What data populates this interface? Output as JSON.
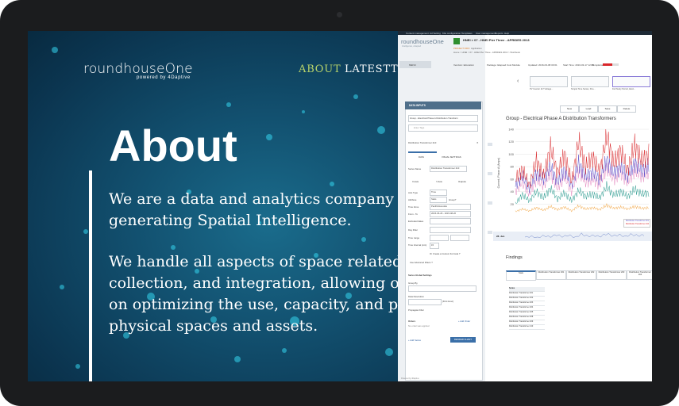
{
  "website": {
    "logo": "roundhouseOne",
    "logo_sub": "powered by 4Daptive",
    "nav": [
      "ABOUT",
      "LATEST",
      "T"
    ],
    "title": "About",
    "paragraphs": [
      "We are a data and analytics company",
      "generating Spatial Intelligence.",
      "We handle all aspects of space related",
      "collection, and integration, allowing ou",
      "on optimizing the use, capacity, and pe",
      "physical spaces and assets."
    ]
  },
  "app": {
    "brand": "roundhouseOne",
    "brand_sub": "Intelligence, Adapted",
    "top_menu": [
      "Content management",
      "Ad Setting",
      "Kite configuration",
      "Templates",
      "User management",
      "Reports",
      "Help"
    ],
    "menu_label": "MENU",
    "header_title": "HNEI > 07 - HNEI Pier Three - APRIDES 2013",
    "project_info": "PROJECT INFO",
    "application": "Application",
    "breadcrumb": "Home > HNEI > 07 - HNEI Pier Three - APRIDES 2013 > Workbook",
    "info": {
      "vendor": "Vendors: Education",
      "package": "Package: Elapsed Cost Module",
      "updated": "Updated: 2016-03-08 03:01",
      "start": "Start Time: 2016-03-17 12:05",
      "completion": "Completion:",
      "completion_fraction": 0.6
    },
    "thumbnails": [
      {
        "label": "PV Inverter 117 Voltage..."
      },
      {
        "label": "Simple Time Series, Peo..."
      },
      {
        "label": "Full Study Period, Elect..."
      }
    ],
    "toolbar": [
      "New",
      "Load",
      "Save",
      "Delete"
    ],
    "data_inputs": {
      "title": "DATA INPUTS",
      "group_select": "Group - Electrical Phase A Distribution Transform",
      "tags_placeholder": "Enter Tags",
      "series_name": "Distribution Transformer 210",
      "tabs": [
        "DATA",
        "VISUAL SETTINGS"
      ],
      "series_name_label": "Series Name",
      "series_name_value": "Distribution Transformer 210",
      "axis_tabs": [
        "X-Axis",
        "Y-Axis",
        "Outputs"
      ],
      "axis_type_label": "Axis Type",
      "axis_type_value": "Time",
      "attribute_label": "Attribute",
      "attribute_value": "Stats",
      "grouped": "Group?",
      "time_zone_label": "Time Zone",
      "time_zone_value": "Pacific/Honolulu",
      "from_to_label": "From - To",
      "from_to_value": "2015-06-26 - 2015-08-26",
      "excluded_label": "Excluded dates",
      "day_filter_label": "Day Filter",
      "time_range_label": "Time range",
      "time_interval_label": "Time Interval (min)",
      "time_interval_value": "15",
      "custom_formula": "Or Create a Custom Formula ?",
      "advanced_filters": "Use Advanced Filters ?",
      "global_settings": "Series Global Settings",
      "group_by": "Group By",
      "data_resolution": "Data Resolution",
      "first_hour": "(First Hour)",
      "propagate_filter": "Propagate Filter",
      "orders": "Orders",
      "add_order": "+ Add Order",
      "no_order": "No order was applied",
      "add_series": "+ Add Series",
      "render_chart": "RENDER CHART"
    },
    "chart_title": "Group - Electrical Phase A Distribution Transformers",
    "legend": [
      "Distribution Transformer 201",
      "Distribution Transformer 210"
    ],
    "navigator_label": "28. Jun",
    "findings": {
      "title": "Findings",
      "tabs": [
        "Stats",
        "Distribution Transformer 201",
        "Distribution Transformer 202",
        "Distribution Transformer 203",
        "Distribution Transformer 204"
      ],
      "rows": [
        "Series",
        "Distribution Transformer 201",
        "Distribution Transformer 202",
        "Distribution Transformer 203",
        "Distribution Transformer 204",
        "Distribution Transformer 205",
        "Distribution Transformer 208",
        "Distribution Transformer 209",
        "Distribution Transformer 210"
      ]
    },
    "footer": "Powered by 4Daptive"
  },
  "chart_data": {
    "type": "line",
    "title": "Group - Electrical Phase A Distribution Transformers",
    "ylabel": "Current, Phase A (Amps)",
    "y_ticks": [
      140,
      120,
      100,
      80,
      60,
      40,
      20
    ],
    "ylim": [
      0,
      140
    ],
    "series": [
      {
        "name": "Distribution Transformer 201",
        "color": "#d9262a",
        "values": [
          60,
          75,
          50,
          90,
          65,
          110,
          70,
          100,
          55,
          120,
          80,
          95,
          70,
          130,
          85,
          105,
          75,
          115,
          90,
          100
        ]
      },
      {
        "name": "Distribution Transformer 210",
        "color": "#5a4fc8",
        "values": [
          50,
          65,
          45,
          70,
          60,
          80,
          55,
          75,
          50,
          85,
          65,
          70,
          60,
          90,
          70,
          80,
          65,
          85,
          75,
          80
        ]
      },
      {
        "color": "#e58ac1",
        "values": [
          40,
          55,
          35,
          60,
          50,
          70,
          45,
          65,
          40,
          75,
          55,
          60,
          50,
          80,
          60,
          70,
          55,
          75,
          65,
          70
        ]
      },
      {
        "color": "#2a9b8f",
        "values": [
          20,
          35,
          25,
          40,
          30,
          45,
          28,
          38,
          25,
          42,
          32,
          36,
          30,
          48,
          34,
          40,
          32,
          44,
          36,
          38
        ]
      },
      {
        "color": "#f2a440",
        "values": [
          8,
          12,
          9,
          14,
          10,
          16,
          11,
          15,
          9,
          17,
          12,
          14,
          11,
          18,
          13,
          15,
          12,
          16,
          13,
          14
        ]
      }
    ]
  }
}
